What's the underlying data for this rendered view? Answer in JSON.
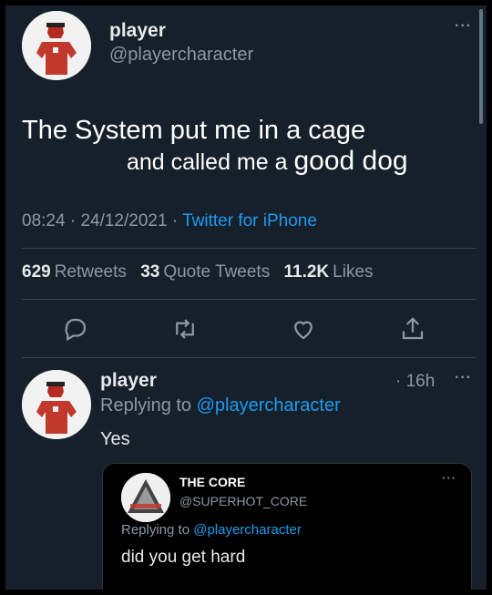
{
  "tweet": {
    "author_name": "player",
    "author_handle": "@playercharacter",
    "text_line1": "The System put me in a cage",
    "text_line2_prefix": "and called me a ",
    "text_line2_emphasis": "good dog",
    "time": "08:24",
    "separator1": " · ",
    "date": "24/12/2021",
    "separator2": " · ",
    "source": "Twitter for iPhone",
    "retweets_count": "629",
    "retweets_label": "Retweets",
    "quote_count": "33",
    "quote_label": "Quote Tweets",
    "likes_count": "11.2K",
    "likes_label": "Likes",
    "more_icon": "more-icon"
  },
  "actions": {
    "icons": [
      "reply-icon",
      "retweet-icon",
      "like-icon",
      "share-icon"
    ]
  },
  "reply": {
    "author_name": "player",
    "age": "· 16h",
    "replying_prefix": "Replying to ",
    "replying_handle": "@playercharacter",
    "text": "Yes",
    "quote": {
      "author_name": "THE CORE",
      "author_handle": "@SUPERHOT_CORE",
      "replying_prefix": "Replying to ",
      "replying_handle": "@playercharacter",
      "text": "did you get hard"
    }
  },
  "colors": {
    "background": "#15202b",
    "link": "#1d9bf0",
    "secondary_text": "#8b98a5",
    "divider": "#38444d",
    "avatar_figure": "#c0392b"
  }
}
